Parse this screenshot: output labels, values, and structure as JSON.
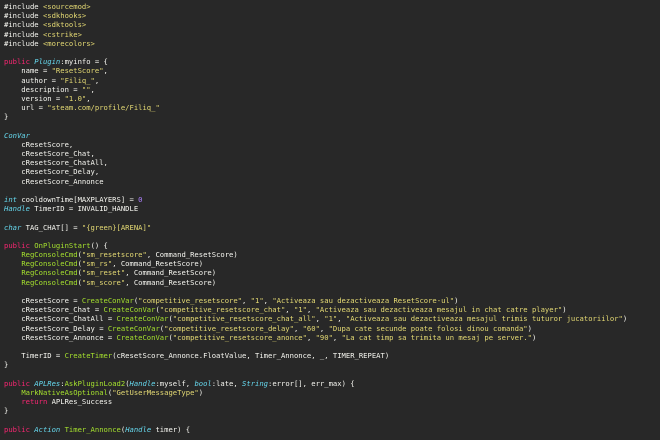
{
  "colors": {
    "background": "#282828",
    "plain": "#f8f8f2",
    "keyword": "#f92672",
    "type": "#66d9ef",
    "function": "#a6e22e",
    "string": "#e6db74",
    "number": "#ae81ff"
  },
  "lines": [
    [
      [
        "#include ",
        "plain"
      ],
      [
        "<sourcemod>",
        "str"
      ]
    ],
    [
      [
        "#include ",
        "plain"
      ],
      [
        "<sdkhooks>",
        "str"
      ]
    ],
    [
      [
        "#include ",
        "plain"
      ],
      [
        "<sdktools>",
        "str"
      ]
    ],
    [
      [
        "#include ",
        "plain"
      ],
      [
        "<cstrike>",
        "str"
      ]
    ],
    [
      [
        "#include ",
        "plain"
      ],
      [
        "<morecolors>",
        "str"
      ]
    ],
    [
      [
        "",
        "plain"
      ]
    ],
    [
      [
        "public ",
        "kw"
      ],
      [
        "Plugin",
        "type"
      ],
      [
        ":myinfo = {",
        "plain"
      ]
    ],
    [
      [
        "    name = ",
        "plain"
      ],
      [
        "\"ResetScore\"",
        "str"
      ],
      [
        ",",
        "plain"
      ]
    ],
    [
      [
        "    author = ",
        "plain"
      ],
      [
        "\"Filiq_\"",
        "str"
      ],
      [
        ",",
        "plain"
      ]
    ],
    [
      [
        "    description = ",
        "plain"
      ],
      [
        "\"\"",
        "str"
      ],
      [
        ",",
        "plain"
      ]
    ],
    [
      [
        "    version = ",
        "plain"
      ],
      [
        "\"1.0\"",
        "str"
      ],
      [
        ",",
        "plain"
      ]
    ],
    [
      [
        "    url = ",
        "plain"
      ],
      [
        "\"steam.com/profile/Filiq_\"",
        "str"
      ]
    ],
    [
      [
        "}",
        "plain"
      ]
    ],
    [
      [
        "",
        "plain"
      ]
    ],
    [
      [
        "ConVar",
        "type"
      ]
    ],
    [
      [
        "    cResetScore,",
        "plain"
      ]
    ],
    [
      [
        "    cResetScore_Chat,",
        "plain"
      ]
    ],
    [
      [
        "    cResetScore_ChatAll,",
        "plain"
      ]
    ],
    [
      [
        "    cResetScore_Delay,",
        "plain"
      ]
    ],
    [
      [
        "    cResetScore_Annonce",
        "plain"
      ]
    ],
    [
      [
        "",
        "plain"
      ]
    ],
    [
      [
        "int ",
        "type"
      ],
      [
        "cooldownTime[MAXPLAYERS] = ",
        "plain"
      ],
      [
        "0",
        "num"
      ]
    ],
    [
      [
        "Handle ",
        "type"
      ],
      [
        "TimerID = INVALID_HANDLE",
        "plain"
      ]
    ],
    [
      [
        "",
        "plain"
      ]
    ],
    [
      [
        "char ",
        "type"
      ],
      [
        "TAG_CHAT[] = ",
        "plain"
      ],
      [
        "\"{green}[ARENA]\"",
        "str"
      ]
    ],
    [
      [
        "",
        "plain"
      ]
    ],
    [
      [
        "public ",
        "kw"
      ],
      [
        "OnPluginStart",
        "fn"
      ],
      [
        "() {",
        "plain"
      ]
    ],
    [
      [
        "    ",
        "plain"
      ],
      [
        "RegConsoleCmd",
        "fn"
      ],
      [
        "(",
        "plain"
      ],
      [
        "\"sm_resetscore\"",
        "str"
      ],
      [
        ", Command_ResetScore)",
        "plain"
      ]
    ],
    [
      [
        "    ",
        "plain"
      ],
      [
        "RegConsoleCmd",
        "fn"
      ],
      [
        "(",
        "plain"
      ],
      [
        "\"sm_rs\"",
        "str"
      ],
      [
        ", Command_ResetScore)",
        "plain"
      ]
    ],
    [
      [
        "    ",
        "plain"
      ],
      [
        "RegConsoleCmd",
        "fn"
      ],
      [
        "(",
        "plain"
      ],
      [
        "\"sm_reset\"",
        "str"
      ],
      [
        ", Command_ResetScore)",
        "plain"
      ]
    ],
    [
      [
        "    ",
        "plain"
      ],
      [
        "RegConsoleCmd",
        "fn"
      ],
      [
        "(",
        "plain"
      ],
      [
        "\"sm_score\"",
        "str"
      ],
      [
        ", Command_ResetScore)",
        "plain"
      ]
    ],
    [
      [
        "",
        "plain"
      ]
    ],
    [
      [
        "    cResetScore = ",
        "plain"
      ],
      [
        "CreateConVar",
        "fn"
      ],
      [
        "(",
        "plain"
      ],
      [
        "\"competitive_resetscore\"",
        "str"
      ],
      [
        ", ",
        "plain"
      ],
      [
        "\"1\"",
        "str"
      ],
      [
        ", ",
        "plain"
      ],
      [
        "\"Activeaza sau dezactiveaza ResetScore-ul\"",
        "str"
      ],
      [
        ")",
        "plain"
      ]
    ],
    [
      [
        "    cResetScore_Chat = ",
        "plain"
      ],
      [
        "CreateConVar",
        "fn"
      ],
      [
        "(",
        "plain"
      ],
      [
        "\"competitive_resetscore_chat\"",
        "str"
      ],
      [
        ", ",
        "plain"
      ],
      [
        "\"1\"",
        "str"
      ],
      [
        ", ",
        "plain"
      ],
      [
        "\"Activeaza sau dezactiveaza mesajul in chat catre player\"",
        "str"
      ],
      [
        ")",
        "plain"
      ]
    ],
    [
      [
        "    cResetScore_ChatAll = ",
        "plain"
      ],
      [
        "CreateConVar",
        "fn"
      ],
      [
        "(",
        "plain"
      ],
      [
        "\"competitive_resetscore_chat_all\"",
        "str"
      ],
      [
        ", ",
        "plain"
      ],
      [
        "\"1\"",
        "str"
      ],
      [
        ", ",
        "plain"
      ],
      [
        "\"Activeaza sau dezactiveaza mesajul trimis tuturor jucatoriilor\"",
        "str"
      ],
      [
        ")",
        "plain"
      ]
    ],
    [
      [
        "    cResetScore_Delay = ",
        "plain"
      ],
      [
        "CreateConVar",
        "fn"
      ],
      [
        "(",
        "plain"
      ],
      [
        "\"competitive_resetscore_delay\"",
        "str"
      ],
      [
        ", ",
        "plain"
      ],
      [
        "\"60\"",
        "str"
      ],
      [
        ", ",
        "plain"
      ],
      [
        "\"Dupa cate secunde poate folosi dinou comanda\"",
        "str"
      ],
      [
        ")",
        "plain"
      ]
    ],
    [
      [
        "    cResetScore_Annonce = ",
        "plain"
      ],
      [
        "CreateConVar",
        "fn"
      ],
      [
        "(",
        "plain"
      ],
      [
        "\"competitive_resetscore_anonce\"",
        "str"
      ],
      [
        ", ",
        "plain"
      ],
      [
        "\"90\"",
        "str"
      ],
      [
        ", ",
        "plain"
      ],
      [
        "\"La cat timp sa trimita un mesaj pe server.\"",
        "str"
      ],
      [
        ")",
        "plain"
      ]
    ],
    [
      [
        "",
        "plain"
      ]
    ],
    [
      [
        "    TimerID = ",
        "plain"
      ],
      [
        "CreateTimer",
        "fn"
      ],
      [
        "(cResetScore_Annonce.FloatValue, Timer_Annonce, _, TIMER_REPEAT)",
        "plain"
      ]
    ],
    [
      [
        "}",
        "plain"
      ]
    ],
    [
      [
        "",
        "plain"
      ]
    ],
    [
      [
        "public ",
        "kw"
      ],
      [
        "APLRes",
        "type"
      ],
      [
        ":",
        "plain"
      ],
      [
        "AskPluginLoad2",
        "fn"
      ],
      [
        "(",
        "plain"
      ],
      [
        "Handle",
        "type"
      ],
      [
        ":myself, ",
        "plain"
      ],
      [
        "bool",
        "type"
      ],
      [
        ":late, ",
        "plain"
      ],
      [
        "String",
        "type"
      ],
      [
        ":error[], err_max) {",
        "plain"
      ]
    ],
    [
      [
        "    ",
        "plain"
      ],
      [
        "MarkNativeAsOptional",
        "fn"
      ],
      [
        "(",
        "plain"
      ],
      [
        "\"GetUserMessageType\"",
        "str"
      ],
      [
        ")",
        "plain"
      ]
    ],
    [
      [
        "    ",
        "plain"
      ],
      [
        "return ",
        "kw"
      ],
      [
        "APLRes_Success",
        "plain"
      ]
    ],
    [
      [
        "}",
        "plain"
      ]
    ],
    [
      [
        "",
        "plain"
      ]
    ],
    [
      [
        "public ",
        "kw"
      ],
      [
        "Action ",
        "type"
      ],
      [
        "Timer_Annonce",
        "fn"
      ],
      [
        "(",
        "plain"
      ],
      [
        "Handle ",
        "type"
      ],
      [
        "timer) {",
        "plain"
      ]
    ]
  ]
}
